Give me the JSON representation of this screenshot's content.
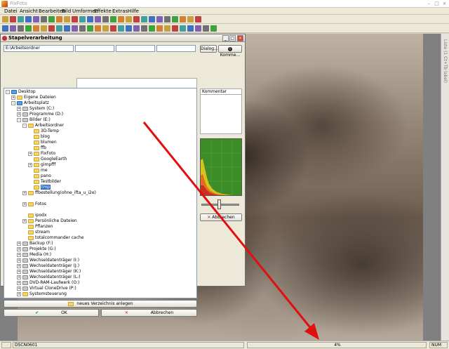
{
  "window": {
    "title": "FixFoto"
  },
  "menu": [
    "Datei",
    "Ansicht",
    "Bearbeiten",
    "Bild",
    "Umformen",
    "Effekte",
    "Extras",
    "Hilfe"
  ],
  "dialog": {
    "title": "Stapelverarbeitung",
    "path": "E:\\Arbeitsordner",
    "dialog_button": "Dialog...",
    "comment_button": "Komme...",
    "comment_header": "Kommentar",
    "cancel_label": "Abbrechen",
    "new_folder_label": "neues Verzeichnis anlegen",
    "ok_label": "OK",
    "cancel_bottom_label": "Abbrechen"
  },
  "tree": [
    {
      "label": "Desktop",
      "icon": "desktop",
      "exp": "-"
    },
    {
      "label": "Eigene Dateien",
      "icon": "folder",
      "exp": "+"
    },
    {
      "label": "Arbeitsplatz",
      "icon": "computer",
      "exp": "-"
    },
    {
      "label": "System (C:)",
      "icon": "drive",
      "exp": "+"
    },
    {
      "label": "Programme (D:)",
      "icon": "drive",
      "exp": "+"
    },
    {
      "label": "Bilder (E:)",
      "icon": "drive",
      "exp": "-"
    },
    {
      "label": "Arbeitsordner",
      "icon": "folder",
      "exp": "-"
    },
    {
      "label": "3D-Temp",
      "icon": "folder",
      "exp": ""
    },
    {
      "label": "blog",
      "icon": "folder",
      "exp": ""
    },
    {
      "label": "blumen",
      "icon": "folder",
      "exp": ""
    },
    {
      "label": "ffb",
      "icon": "folder",
      "exp": ""
    },
    {
      "label": "FixFoto",
      "icon": "folder",
      "exp": "+"
    },
    {
      "label": "GoogleEarth",
      "icon": "folder",
      "exp": ""
    },
    {
      "label": "gimpfff",
      "icon": "folder",
      "exp": "+"
    },
    {
      "label": "me",
      "icon": "folder",
      "exp": ""
    },
    {
      "label": "pano",
      "icon": "folder",
      "exp": ""
    },
    {
      "label": "Testbilder",
      "icon": "folder",
      "exp": ""
    },
    {
      "label": "tmp",
      "icon": "folder",
      "exp": "",
      "selected": true
    },
    {
      "label": "ffbestellung(ohne_ifta_u_i2e)",
      "icon": "folder",
      "exp": "+"
    },
    {
      "label": "",
      "icon": "",
      "exp": ""
    },
    {
      "label": "Fotos",
      "icon": "folder",
      "exp": "+"
    },
    {
      "label": "",
      "icon": "",
      "exp": ""
    },
    {
      "label": "ipodx",
      "icon": "folder",
      "exp": ""
    },
    {
      "label": "Persönliche Dateien",
      "icon": "folder",
      "exp": "+"
    },
    {
      "label": "Pflanzen",
      "icon": "folder",
      "exp": ""
    },
    {
      "label": "stream",
      "icon": "folder",
      "exp": ""
    },
    {
      "label": "totalcommander cache",
      "icon": "folder",
      "exp": ""
    },
    {
      "label": "Backup (F:)",
      "icon": "drive",
      "exp": "+"
    },
    {
      "label": "Projekte (G:)",
      "icon": "drive",
      "exp": "+"
    },
    {
      "label": "Media (H:)",
      "icon": "drive",
      "exp": "+"
    },
    {
      "label": "Wechseldatenträger (I:)",
      "icon": "drive",
      "exp": "+"
    },
    {
      "label": "Wechseldatenträger (J:)",
      "icon": "drive",
      "exp": "+"
    },
    {
      "label": "Wechseldatenträger (K:)",
      "icon": "drive",
      "exp": "+"
    },
    {
      "label": "Wechseldatenträger (L:)",
      "icon": "drive",
      "exp": "+"
    },
    {
      "label": "DVD-RAM-Laufwerk (O:)",
      "icon": "drive",
      "exp": "+"
    },
    {
      "label": "Virtual CloneDrive (P:)",
      "icon": "drive",
      "exp": "+"
    },
    {
      "label": "Systemsteuerung",
      "icon": "folder",
      "exp": "+"
    }
  ],
  "status": {
    "filename": "DSCN0601",
    "zoom": "4%",
    "num": "NUM"
  },
  "palette_label": "Liste (1 Ct+Tb label)",
  "colors": {
    "arrow": "#e01010",
    "selection": "#316ac5"
  }
}
